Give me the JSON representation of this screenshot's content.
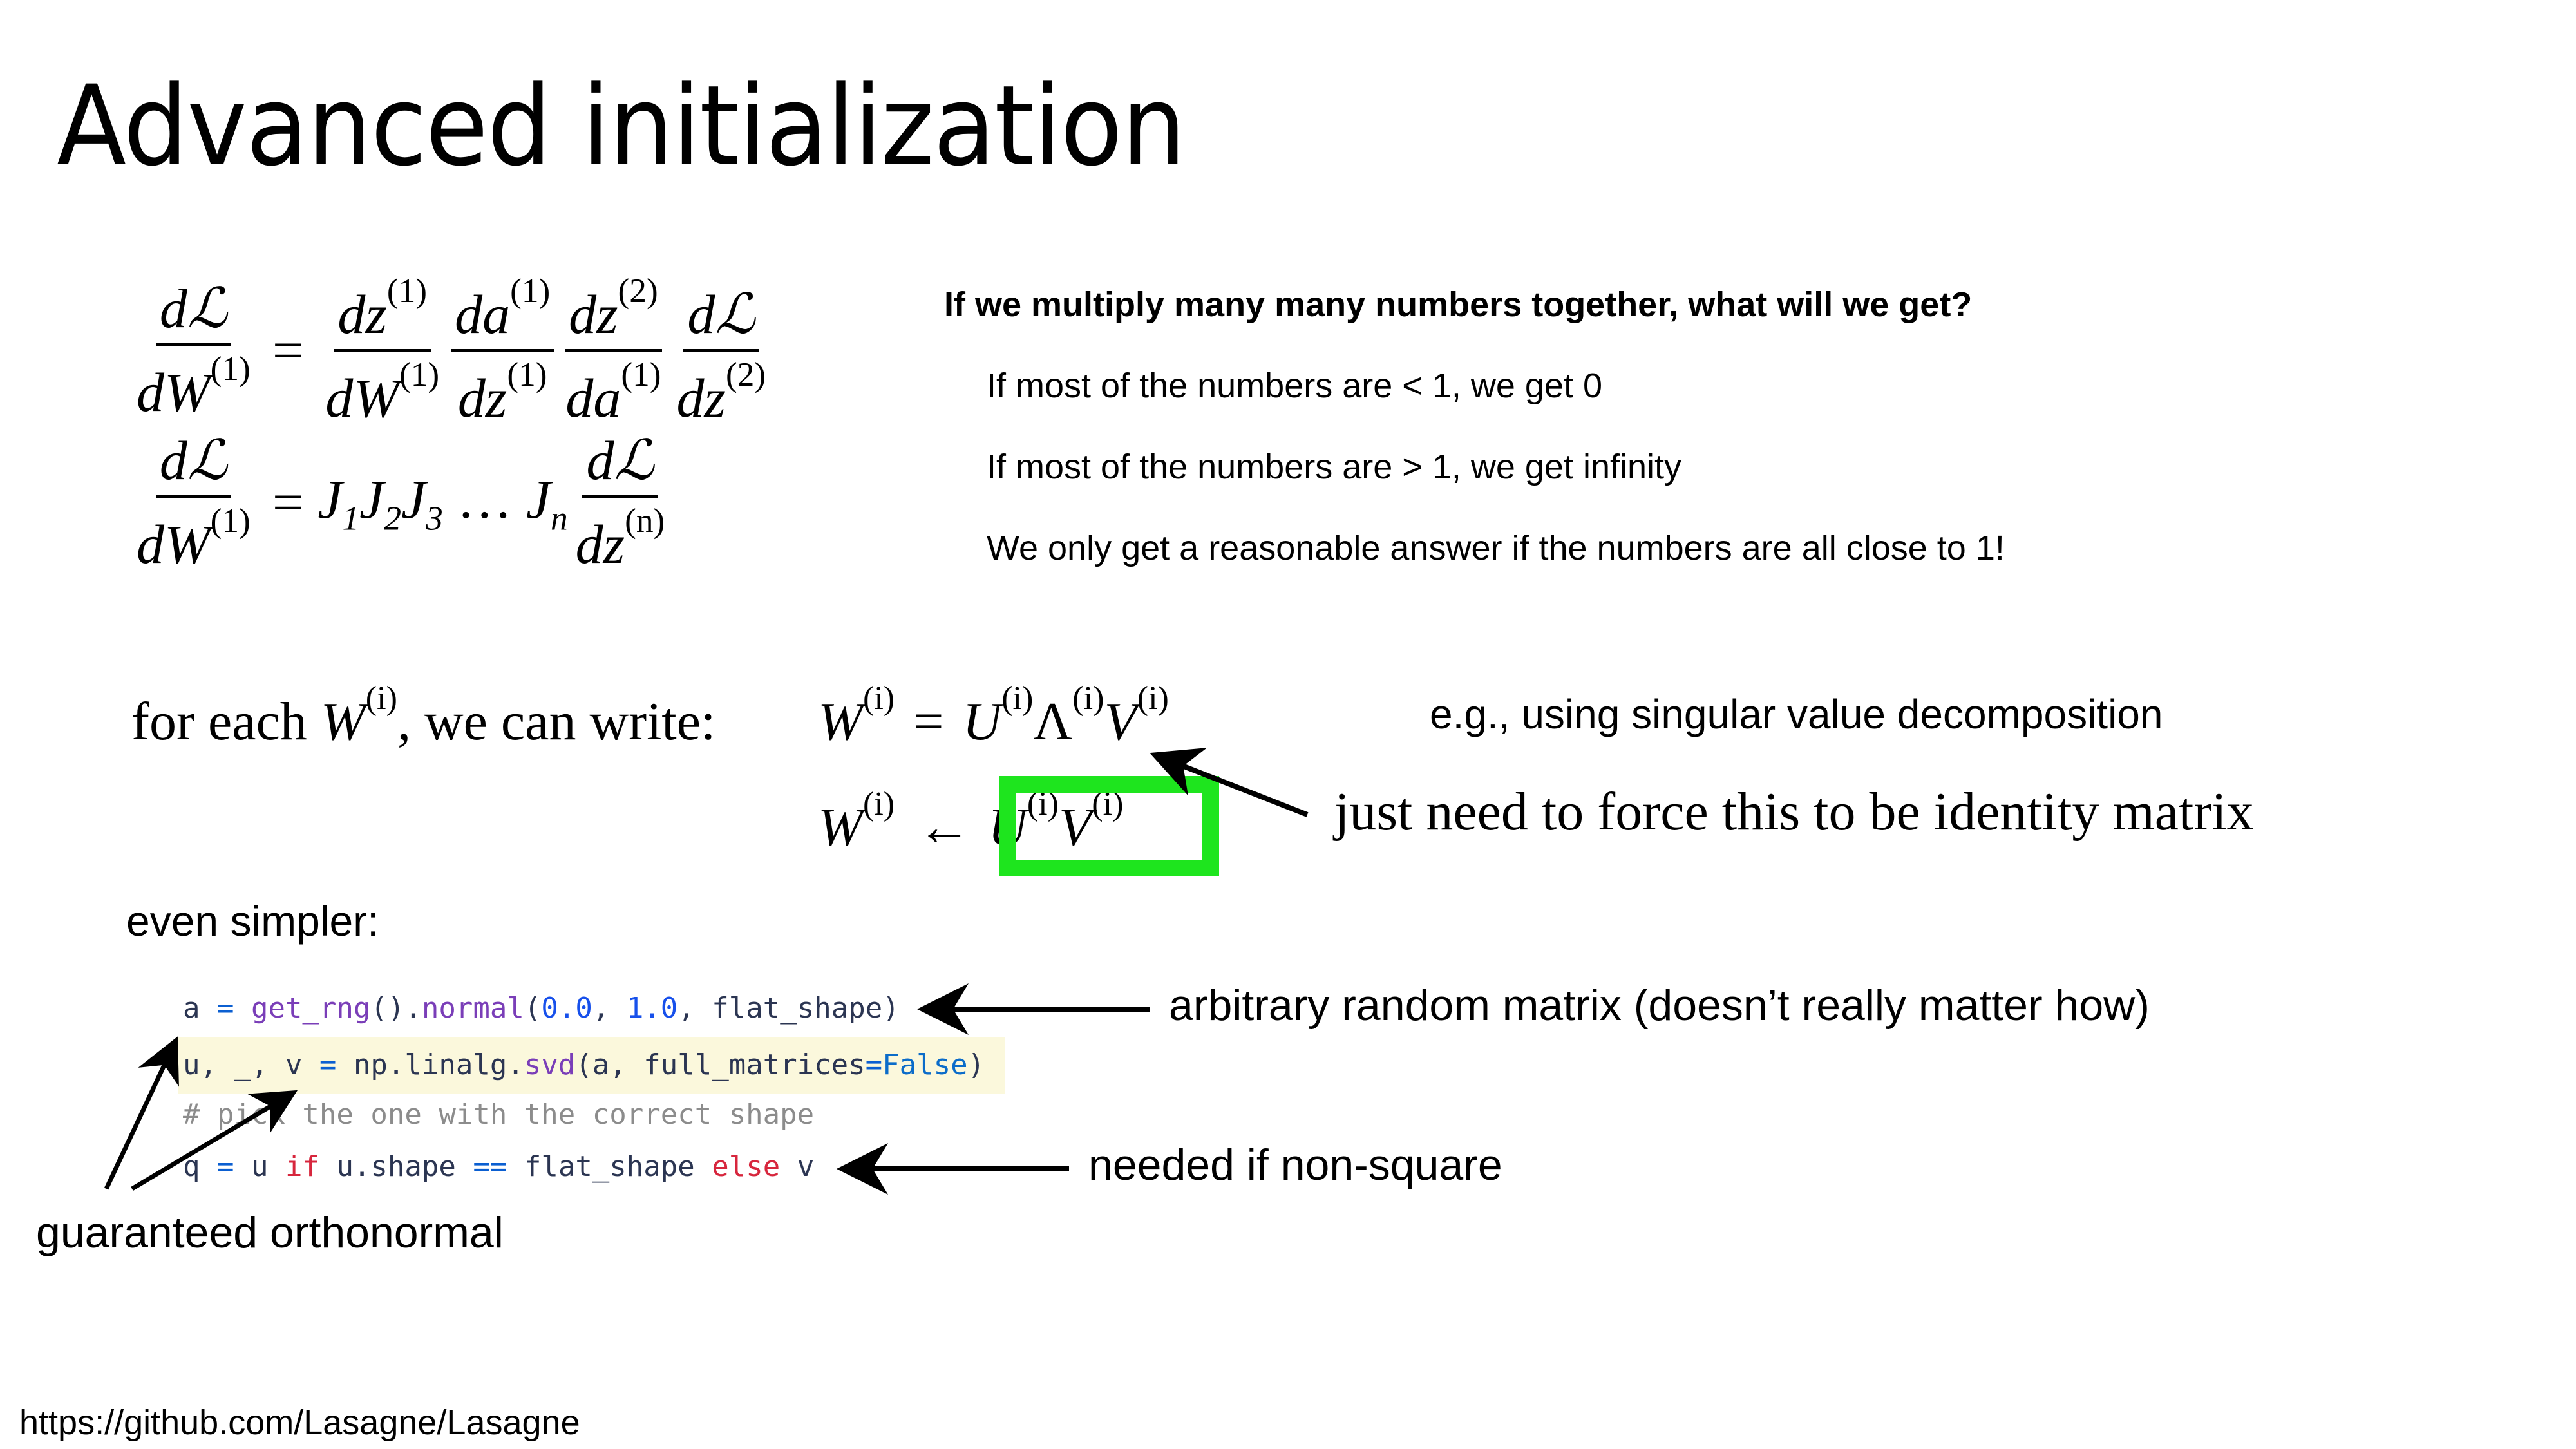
{
  "slide": {
    "title": "Advanced initialization",
    "equations": {
      "eq1": {
        "lhs_num": "dℒ",
        "lhs_den": "dW",
        "lhs_den_sup": "(1)",
        "equals": "=",
        "factors": [
          {
            "num": "dz",
            "num_sup": "(1)",
            "den": "dW",
            "den_sup": "(1)"
          },
          {
            "num": "da",
            "num_sup": "(1)",
            "den": "dz",
            "den_sup": "(1)"
          },
          {
            "num": "dz",
            "num_sup": "(2)",
            "den": "da",
            "den_sup": "(1)"
          },
          {
            "num": "dℒ",
            "num_sup": "",
            "den": "dz",
            "den_sup": "(2)"
          }
        ]
      },
      "eq2": {
        "lhs_num": "dℒ",
        "lhs_den": "dW",
        "lhs_den_sup": "(1)",
        "equals": "=",
        "jacobians": "J",
        "j_subs": [
          "1",
          "2",
          "3"
        ],
        "dots": "…",
        "j_last_sub": "n",
        "rhs_num": "dℒ",
        "rhs_den": "dz",
        "rhs_den_sup": "(n)"
      }
    },
    "question": {
      "heading": "If we multiply many many numbers together, what will we get?",
      "answers": [
        "If most of the numbers are < 1, we get 0",
        "If most of the numbers are > 1, we get infinity",
        "We only get a reasonable answer if the numbers are all close to 1!"
      ]
    },
    "svd": {
      "intro_text": "for each",
      "intro_var": "W",
      "intro_sup": "(i)",
      "intro_tail": ", we can write:",
      "rhs_W": "W",
      "rhs_U": "U",
      "rhs_Lambda": "Λ",
      "rhs_V": "V",
      "sup": "(i)",
      "equals": "=",
      "arrow": "←",
      "note": "e.g., using singular value decomposition",
      "identity_note": "just need to force this to be identity matrix",
      "highlight_color": "#1ee51e"
    },
    "simpler_label": "even simpler:",
    "code": {
      "line1": {
        "a": "a",
        "eq": " = ",
        "fn": "get_rng",
        "paren": "().",
        "fn2": "normal",
        "open": "(",
        "n1": "0.0",
        "c1": ", ",
        "n2": "1.0",
        "c2": ", flat_shape)"
      },
      "line2": {
        "lhs": "u, _, v",
        "eq": " = ",
        "mod": "np.linalg.",
        "fn": "svd",
        "args": "(a, full_matrices",
        "eq2": "=",
        "bool": "False",
        "close": ")"
      },
      "line3": {
        "comment": "# pick the one with the correct shape"
      },
      "line4": {
        "q": "q",
        "eq": " = ",
        "u": "u ",
        "kw_if": "if",
        "mid": " u.shape ",
        "eqeq": "==",
        "flat": " flat_shape ",
        "kw_else": "else",
        "v": " v"
      },
      "highlight_color": "#fbf8dc"
    },
    "annotations": {
      "random_matrix": "arbitrary random matrix (doesn’t really matter how)",
      "non_square": "needed if non-square",
      "orthonormal": "guaranteed orthonormal"
    },
    "source_url": "https://github.com/Lasagne/Lasagne"
  }
}
